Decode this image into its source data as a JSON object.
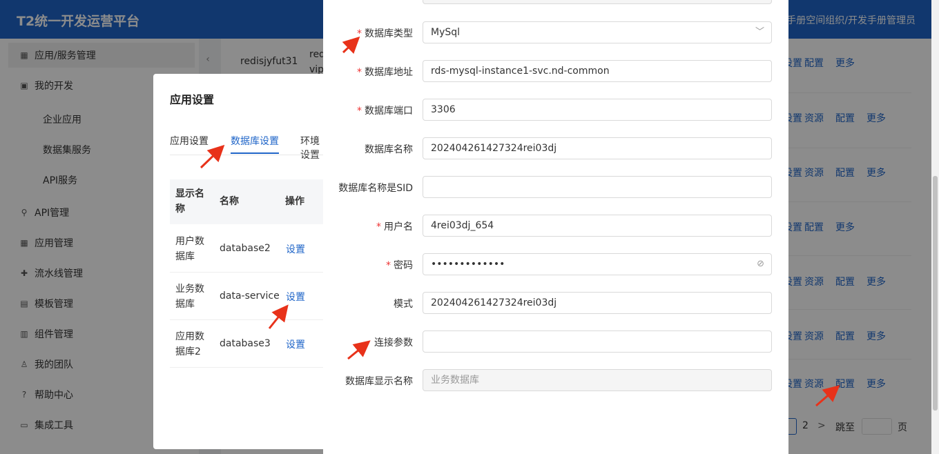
{
  "header": {
    "brand": "T2统一开发运营平台",
    "breadcrumb": "手册空间组织/开发手册管理员"
  },
  "sidebar": {
    "collapse_icon": "‹",
    "items": [
      {
        "label": "应用/服务管理",
        "icon": "grid-icon"
      },
      {
        "label": "我的开发",
        "icon": "code-icon"
      },
      {
        "label": "API管理",
        "icon": "link-icon"
      },
      {
        "label": "应用管理",
        "icon": "apps-icon"
      },
      {
        "label": "流水线管理",
        "icon": "pipeline-icon"
      },
      {
        "label": "模板管理",
        "icon": "template-icon"
      },
      {
        "label": "组件管理",
        "icon": "component-icon"
      },
      {
        "label": "我的团队",
        "icon": "team-icon"
      },
      {
        "label": "帮助中心",
        "icon": "help-icon"
      },
      {
        "label": "集成工具",
        "icon": "folder-icon"
      }
    ],
    "subitems": [
      "企业应用",
      "数据集服务",
      "API服务"
    ]
  },
  "background_table": {
    "row1_name": "redisjyfut31",
    "row1_col2_a": "red",
    "row1_col2_b": "vip.",
    "actions": {
      "settings": "设置",
      "resource": "资源",
      "config": "配置",
      "more": "更多"
    },
    "pager": {
      "page2": "2",
      "next": ">",
      "goto": "跳至",
      "page_suffix": "页"
    }
  },
  "app_modal": {
    "title": "应用设置",
    "tabs": [
      "应用设置",
      "数据库设置",
      "环境设置"
    ],
    "columns": [
      "显示名称",
      "名称",
      "操作"
    ],
    "rows": [
      {
        "display": "用户数据库",
        "name": "database2",
        "action": "设置"
      },
      {
        "display": "业务数据库",
        "name": "data-service",
        "action": "设置"
      },
      {
        "display": "应用数据库2",
        "name": "database3",
        "action": "设置"
      }
    ]
  },
  "db_form": {
    "fields": [
      {
        "label": "数据库类型",
        "required": true,
        "value": "MySql",
        "type": "select"
      },
      {
        "label": "数据库地址",
        "required": true,
        "value": "rds-mysql-instance1-svc.nd-common"
      },
      {
        "label": "数据库端口",
        "required": true,
        "value": "3306"
      },
      {
        "label": "数据库名称",
        "required": false,
        "value": "202404261427324rei03dj"
      },
      {
        "label": "数据库名称是SID",
        "required": false,
        "value": ""
      },
      {
        "label": "用户名",
        "required": true,
        "value": "4rei03dj_654"
      },
      {
        "label": "密码",
        "required": true,
        "value": "•••••••••••••",
        "type": "password"
      },
      {
        "label": "模式",
        "required": false,
        "value": "202404261427324rei03dj"
      },
      {
        "label": "连接参数",
        "required": false,
        "value": ""
      },
      {
        "label": "数据库显示名称",
        "required": false,
        "value": "业务数据库",
        "disabled": true
      }
    ],
    "required_mark": "*",
    "select_arrow": "﹀",
    "eye_icon": "⊘"
  },
  "colors": {
    "primary": "#1f65c8",
    "required": "#e33",
    "arrow": "#e8321a"
  }
}
